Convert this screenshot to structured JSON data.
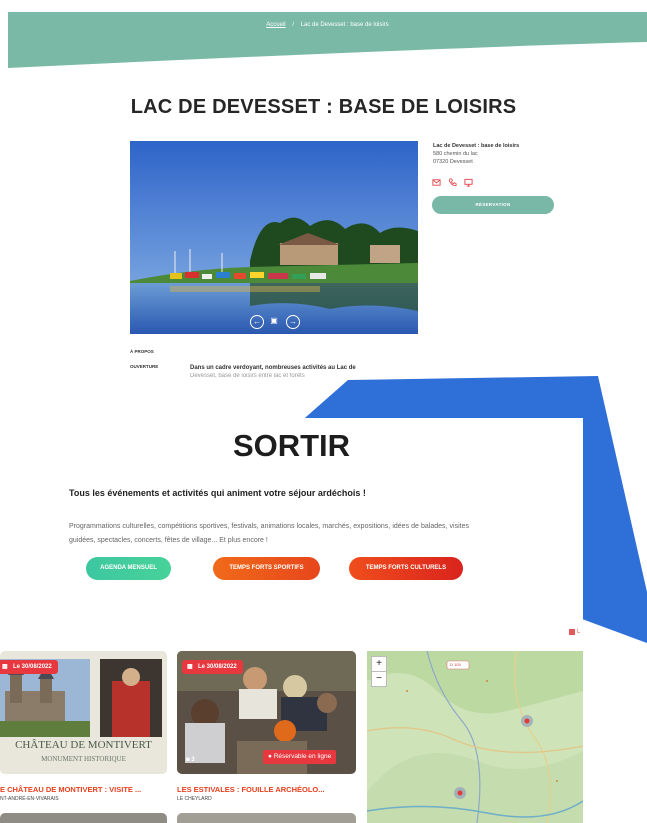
{
  "breadcrumb": {
    "home": "Accueil",
    "separator": "/",
    "current": "Lac de Devesset : base de loisirs"
  },
  "page": {
    "title": "LAC DE DEVESSET : BASE DE LOISIRS"
  },
  "hero": {
    "prev_icon": "←",
    "gallery_icon": "▣",
    "next_icon": "→"
  },
  "address": {
    "name": "Lac de Devesset : base de loisirs",
    "street": "580 chemin du lac",
    "city": "07320 Devesset"
  },
  "contact_icons": [
    "mail-icon",
    "phone-icon",
    "website-icon"
  ],
  "booking": {
    "label": "RÉSERVATION"
  },
  "tabs": [
    {
      "label": "À PROPOS"
    },
    {
      "label": "OUVERTURE"
    }
  ],
  "intro": {
    "lead": "Dans un cadre verdoyant, nombreuses activités au Lac de",
    "cut_line": "Devesset, base de loisirs entre lac et forêts"
  },
  "sortir": {
    "title": "SORTIR",
    "subtitle": "Tous les événements et activités qui animent votre séjour ardéchois !",
    "description": "Programmations culturelles, compétitions sportives, festivals, animations locales, marchés, expositions, idées de balades, visites guidées, spectacles, concerts, fêtes de village... Et plus encore !",
    "buttons": [
      {
        "label": "AGENDA MENSUEL"
      },
      {
        "label": "TEMPS FORTS SPORTIFS"
      },
      {
        "label": "TEMPS FORTS CULTURELS"
      }
    ],
    "legend": "L"
  },
  "cards": [
    {
      "date": "Le 30/08/2022",
      "image_caption": "CHÂTEAU DE MONTIVERT",
      "image_subcaption": "MONUMENT HISTORIQUE",
      "title": "E CHÂTEAU DE MONTIVERT : VISITE ...",
      "location": "NT-ANDRÉ-EN-VIVARAIS"
    },
    {
      "date": "Le 30/08/2022",
      "photo_count": "3",
      "online_badge": "● Réservable en ligne",
      "title": "LES ESTIVALES : FOUILLE ARCHÉOLO...",
      "location": "LE CHEYLARD"
    }
  ],
  "map": {
    "zoom_in": "+",
    "zoom_out": "−",
    "road_label": "D 105"
  },
  "colors": {
    "banner": "#7ab9a5",
    "overlay_blue": "#2e6fd8",
    "accent_red": "#e8383f",
    "booking": "#79b8a6"
  }
}
